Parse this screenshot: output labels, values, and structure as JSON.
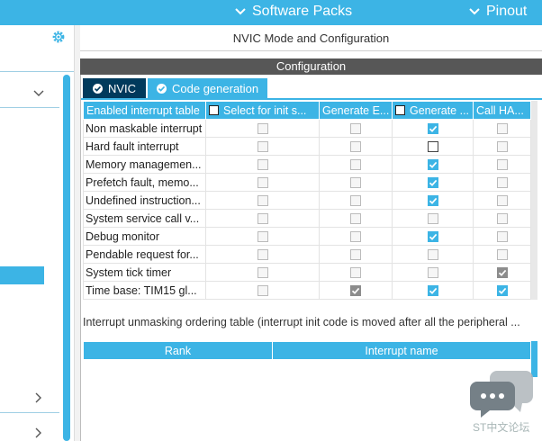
{
  "topbar": {
    "software_packs": "Software Packs",
    "pinout": "Pinout"
  },
  "main": {
    "title": "NVIC Mode and Configuration",
    "config_header": "Configuration",
    "tabs": [
      {
        "label": "NVIC"
      },
      {
        "label": "Code generation"
      }
    ]
  },
  "interrupt_table": {
    "columns": [
      "Enabled interrupt table",
      "Select for init s...",
      "Generate E...",
      "Generate ...",
      "Call HA..."
    ],
    "rows": [
      {
        "name": "Non maskable interrupt",
        "select_init": "off-disabled",
        "gen_enable": "off-disabled",
        "gen_irq": "checked",
        "call_hal": "off-disabled"
      },
      {
        "name": "Hard fault interrupt",
        "select_init": "off-disabled",
        "gen_enable": "off-disabled",
        "gen_irq": "unchecked",
        "call_hal": "off-disabled"
      },
      {
        "name": "Memory managemen...",
        "select_init": "off-disabled",
        "gen_enable": "off-disabled",
        "gen_irq": "checked",
        "call_hal": "off-disabled"
      },
      {
        "name": "Prefetch fault, memo...",
        "select_init": "off-disabled",
        "gen_enable": "off-disabled",
        "gen_irq": "checked",
        "call_hal": "off-disabled"
      },
      {
        "name": "Undefined instruction...",
        "select_init": "off-disabled",
        "gen_enable": "off-disabled",
        "gen_irq": "checked",
        "call_hal": "off-disabled"
      },
      {
        "name": "System service call v...",
        "select_init": "off-disabled",
        "gen_enable": "off-disabled",
        "gen_irq": "off-disabled",
        "call_hal": "off-disabled"
      },
      {
        "name": "Debug monitor",
        "select_init": "off-disabled",
        "gen_enable": "off-disabled",
        "gen_irq": "checked",
        "call_hal": "off-disabled"
      },
      {
        "name": "Pendable request for...",
        "select_init": "off-disabled",
        "gen_enable": "off-disabled",
        "gen_irq": "off-disabled",
        "call_hal": "off-disabled"
      },
      {
        "name": "System tick timer",
        "select_init": "off-disabled",
        "gen_enable": "off-disabled",
        "gen_irq": "off-disabled",
        "call_hal": "checked-gray"
      },
      {
        "name": "Time base: TIM15 gl...",
        "select_init": "off-disabled",
        "gen_enable": "checked-gray",
        "gen_irq": "checked",
        "call_hal": "checked"
      }
    ]
  },
  "ordering_note": "Interrupt unmasking ordering table (interrupt init code is moved after all the peripheral ...",
  "rank_table": {
    "columns": [
      "Rank",
      "Interrupt name"
    ]
  },
  "watermark": {
    "text": "ST中文论坛"
  },
  "colors": {
    "accent": "#3cb4e5",
    "tab_active": "#003a5c",
    "config_bar": "#575757"
  }
}
